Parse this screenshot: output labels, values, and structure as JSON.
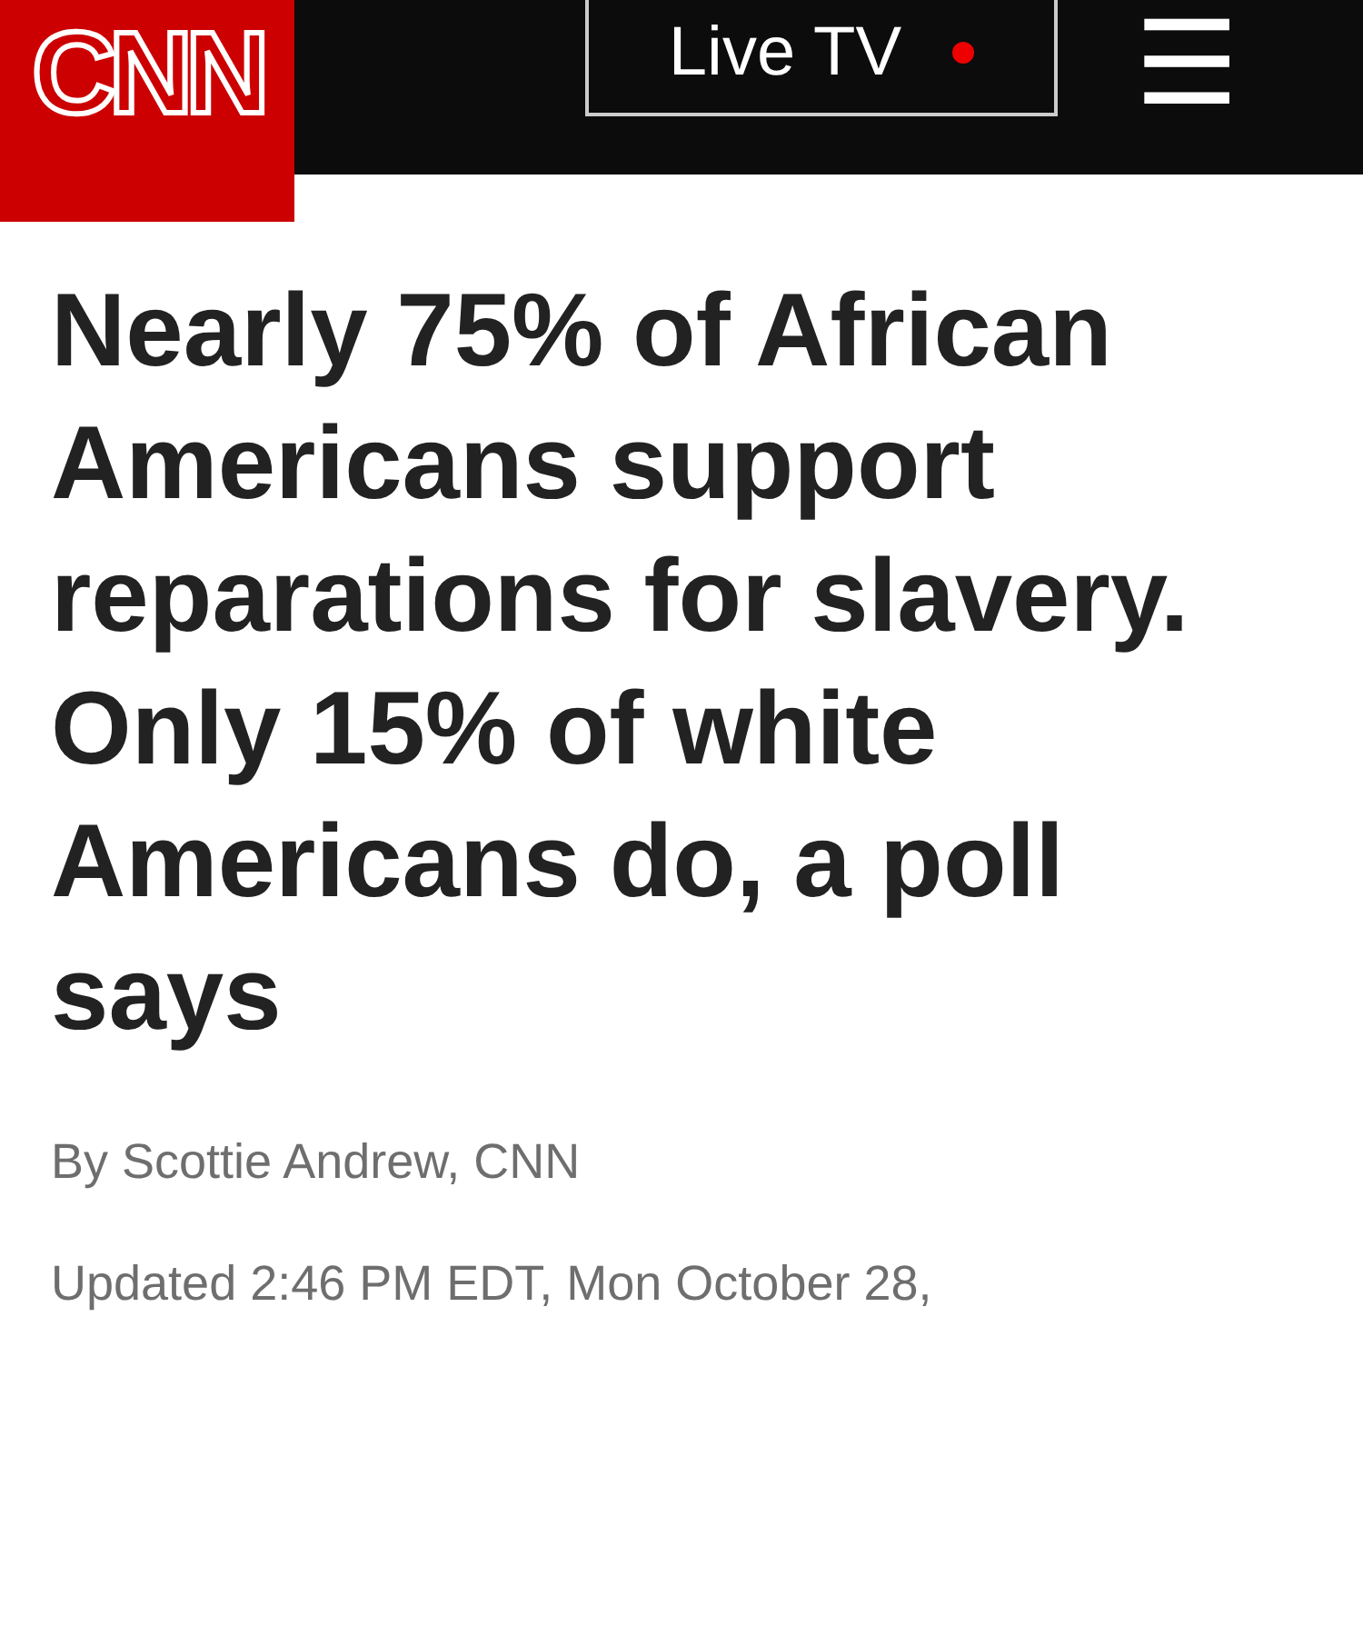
{
  "header": {
    "logo": "CNN",
    "live_button": {
      "label": "Live TV",
      "live": true
    },
    "menu_icon": "☰"
  },
  "article": {
    "headline": "Nearly 75% of African Americans support reparations for slavery. Only 15% of white Americans do, a poll says",
    "byline": "By Scottie Andrew, CNN",
    "updated": "Updated 2:46 PM EDT, Mon October 28,"
  }
}
